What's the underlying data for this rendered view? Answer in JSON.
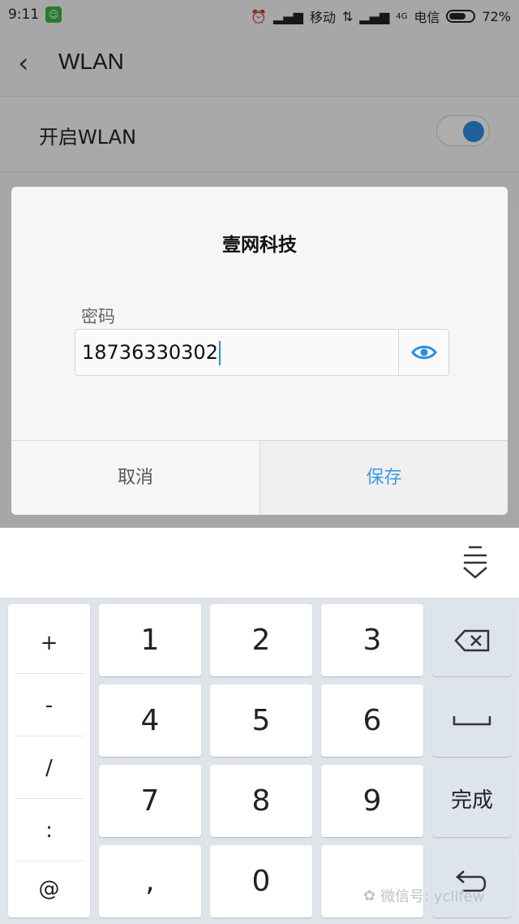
{
  "status_bar": {
    "time": "9:11",
    "carrier1": "移动",
    "carrier2": "电信",
    "network_type": "4G",
    "battery_text": "72%",
    "battery_level": 0.72
  },
  "settings": {
    "title": "WLAN",
    "wlan_toggle_label": "开启WLAN",
    "wlan_enabled": true,
    "accent_color": "#2d8ee0"
  },
  "dialog": {
    "title": "壹网科技",
    "password_label": "密码",
    "password_value": "18736330302",
    "cancel_label": "取消",
    "save_label": "保存"
  },
  "keyboard": {
    "symbols": [
      "+",
      "-",
      "/",
      ":",
      "@"
    ],
    "digits": [
      "1",
      "2",
      "3",
      "4",
      "5",
      "6",
      "7",
      "8",
      "9",
      ",",
      "0"
    ],
    "done_label": "完成",
    "backspace_icon": "backspace-icon",
    "space_icon": "space-icon",
    "enter_icon": "enter-icon"
  },
  "watermark": {
    "text": "微信号: ycllfew"
  }
}
